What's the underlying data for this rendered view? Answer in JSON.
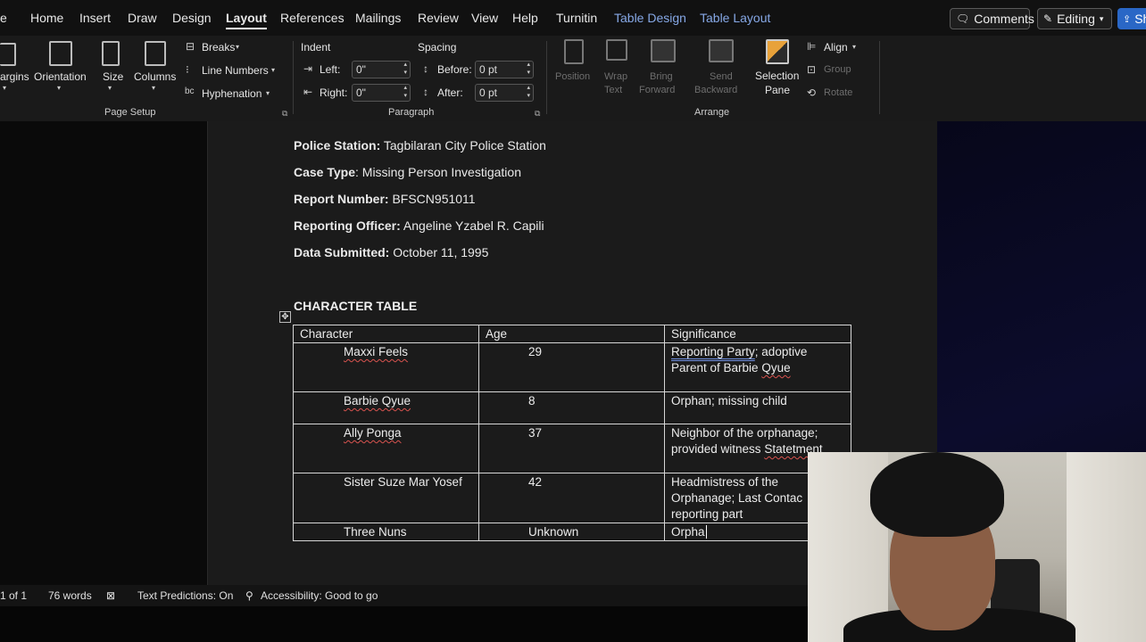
{
  "tabs": [
    "e",
    "Home",
    "Insert",
    "Draw",
    "Design",
    "Layout",
    "References",
    "Mailings",
    "Review",
    "View",
    "Help",
    "Turnitin",
    "Table Design",
    "Table Layout"
  ],
  "active_tab": "Layout",
  "top_buttons": {
    "comments": "Comments",
    "editing": "Editing",
    "share": "Sh"
  },
  "ribbon": {
    "page_setup": {
      "margins": "argins",
      "orientation": "Orientation",
      "size": "Size",
      "columns": "Columns",
      "breaks": "Breaks",
      "line_numbers": "Line Numbers",
      "hyphenation": "Hyphenation",
      "group_label": "Page Setup"
    },
    "paragraph": {
      "indent_label": "Indent",
      "spacing_label": "Spacing",
      "left_label": "Left:",
      "left_value": "0\"",
      "right_label": "Right:",
      "right_value": "0\"",
      "before_label": "Before:",
      "before_value": "0 pt",
      "after_label": "After:",
      "after_value": "0 pt",
      "group_label": "Paragraph"
    },
    "arrange": {
      "position": "Position",
      "wrap1": "Wrap",
      "wrap2": "Text",
      "bring1": "Bring",
      "bring2": "Forward",
      "send1": "Send",
      "send2": "Backward",
      "selection1": "Selection",
      "selection2": "Pane",
      "align": "Align",
      "group": "Group",
      "rotate": "Rotate",
      "group_label": "Arrange"
    }
  },
  "document": {
    "fields": [
      {
        "label": "Police Station:",
        "value": "Tagbilaran City Police Station"
      },
      {
        "label": "Case Type",
        "value": ": Missing Person Investigation"
      },
      {
        "label": "Report Number:",
        "value": "BFSCN951011"
      },
      {
        "label": "Reporting Officer:",
        "value": "Angeline Yzabel R. Capili"
      },
      {
        "label": "Data Submitted:",
        "value": "October 11, 1995"
      }
    ],
    "table_title": "CHARACTER TABLE",
    "table": {
      "headers": [
        "Character",
        "Age",
        "Significance"
      ],
      "rows": [
        {
          "character": "Maxxi Feels",
          "age": "29",
          "sig1": "Reporting Party",
          "sig2": "; adoptive",
          "sig3": "Parent of Barbie ",
          "sig4": "Qyue"
        },
        {
          "character": "Barbie Qyue",
          "age": "8",
          "significance": "Orphan; missing child"
        },
        {
          "character": "Ally Ponga",
          "age": "37",
          "sig1": "Neighbor of the orphanage;",
          "sig2": "provided witness ",
          "sig3": "Statetment"
        },
        {
          "character": "Sister Suze Mar Yosef",
          "age": "42",
          "sig1": "Headmistress of the",
          "sig2": "Orphanage; Last Contac",
          "sig3": "reporting part"
        },
        {
          "character": "Three Nuns",
          "age": "Unknown",
          "significance": "Orpha"
        }
      ]
    }
  },
  "status": {
    "page": "1 of 1",
    "words": "76 words",
    "predictions": "Text Predictions: On",
    "accessibility": "Accessibility: Good to go"
  }
}
